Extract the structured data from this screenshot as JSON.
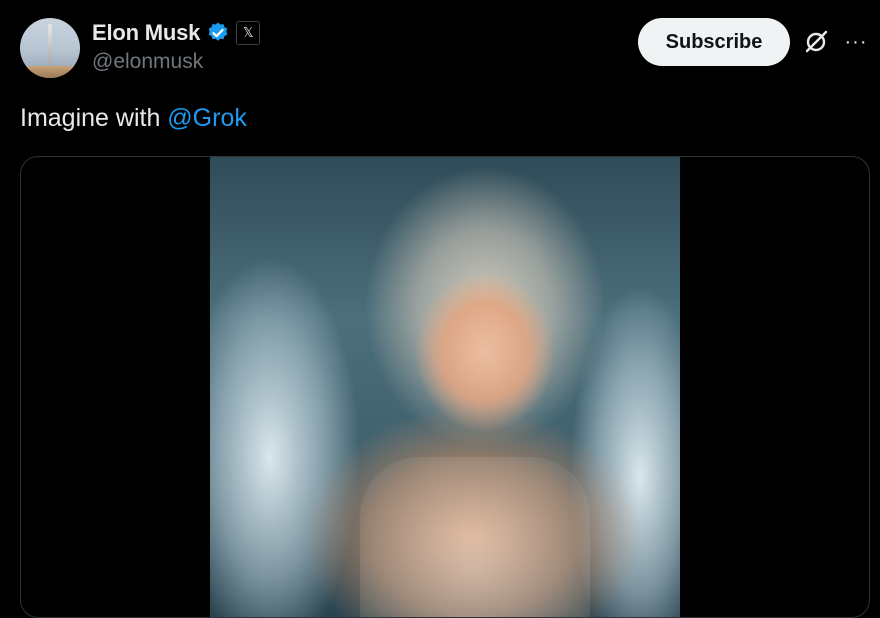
{
  "author": {
    "display_name": "Elon Musk",
    "handle": "@elonmusk",
    "verified_icon": "verified-badge-icon",
    "affiliation_icon": "x-logo-icon",
    "affiliation_glyph": "𝕏"
  },
  "actions": {
    "subscribe_label": "Subscribe",
    "grok_icon": "grok-icon",
    "more_icon": "more-icon",
    "more_glyph": "···"
  },
  "tweet": {
    "text": "Imagine with ",
    "mention": "@Grok"
  },
  "colors": {
    "background": "#000000",
    "text": "#e7e9ea",
    "muted": "#71767b",
    "accent": "#1d9bf0",
    "subscribe_bg": "#eff3f4"
  }
}
